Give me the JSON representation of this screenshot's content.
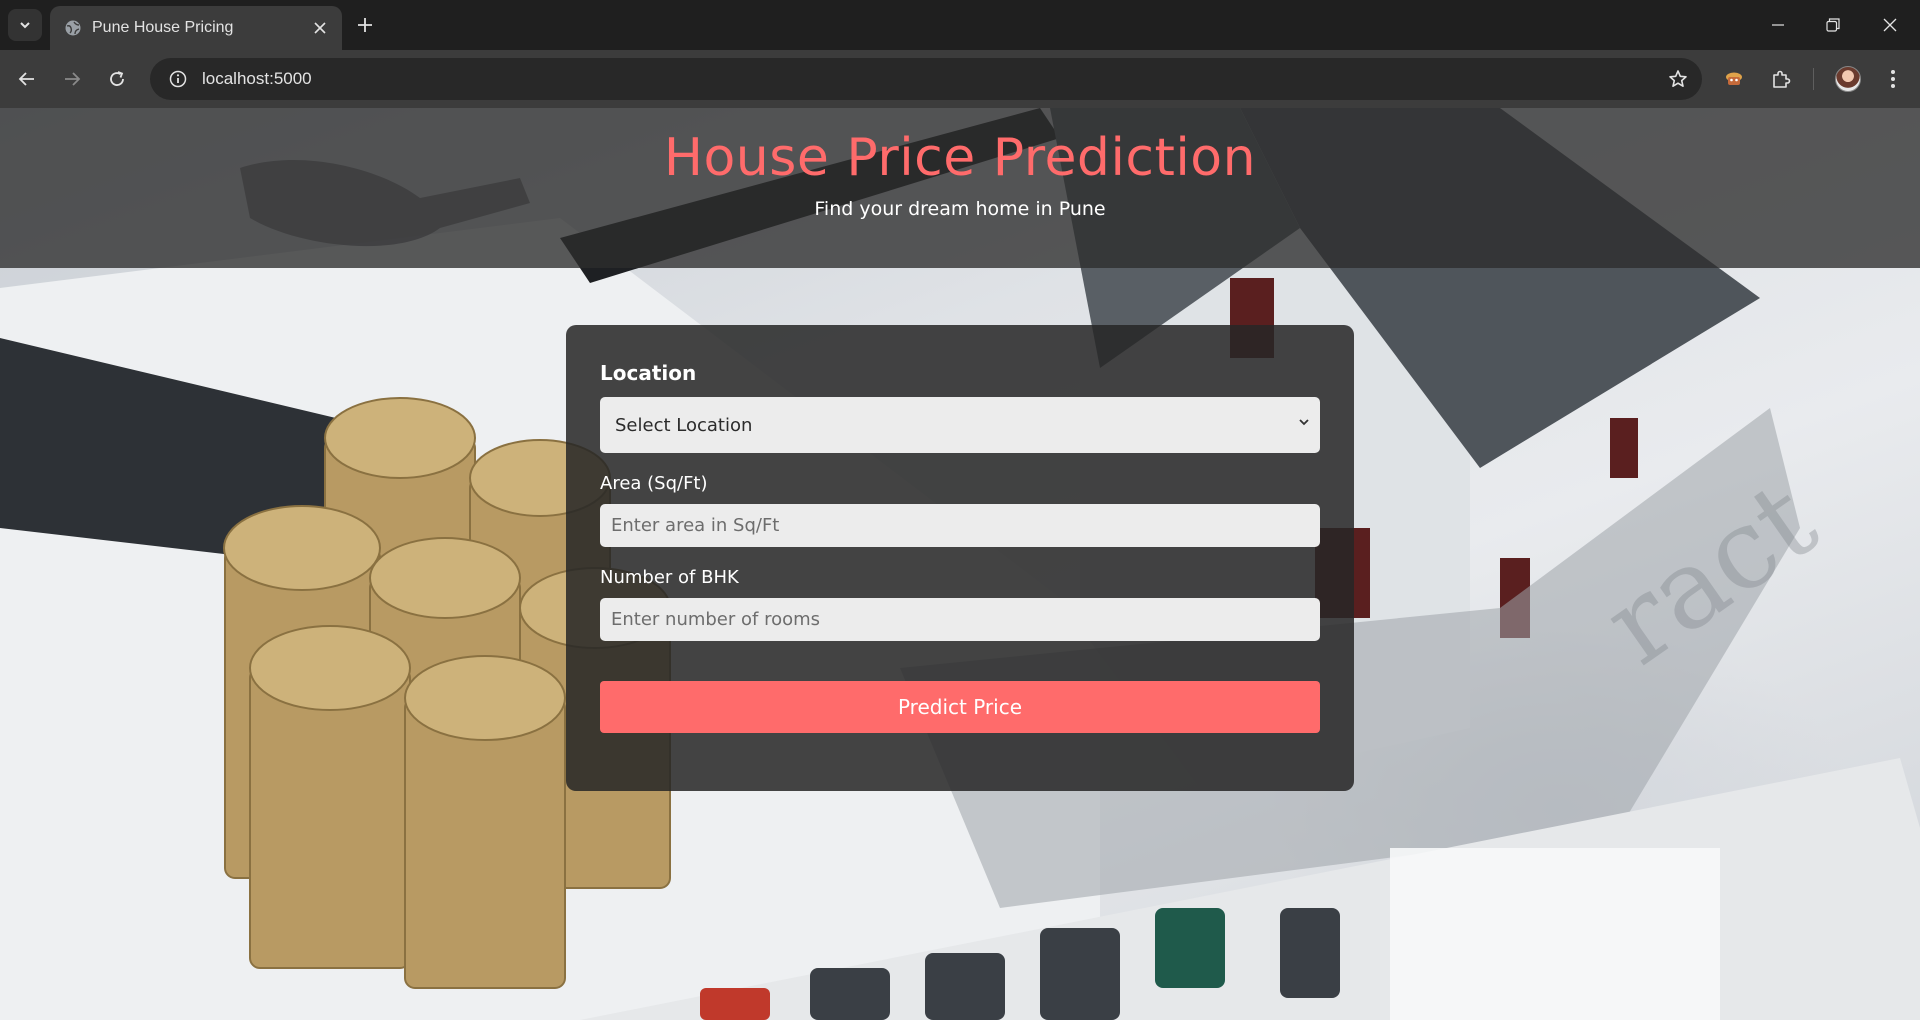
{
  "browser": {
    "tab": {
      "title": "Pune House Pricing",
      "favicon": "globe-icon"
    },
    "address": {
      "url": "localhost:5000"
    },
    "icons": {
      "tab_search": "chevron-down-icon",
      "close_tab": "close-icon",
      "new_tab": "plus-icon",
      "back": "arrow-left-icon",
      "forward": "arrow-right-icon",
      "reload": "reload-icon",
      "site_info": "info-icon",
      "bookmark": "star-icon",
      "extension": "puzzle-icon",
      "menu": "kebab-menu-icon"
    }
  },
  "page": {
    "title": "House Price Prediction",
    "subtitle": "Find your dream home in Pune",
    "form": {
      "location_label": "Location",
      "location_selected": "Select Location",
      "area_label": "Area (Sq/Ft)",
      "area_placeholder": "Enter area in Sq/Ft",
      "bhk_label": "Number of BHK",
      "bhk_placeholder": "Enter number of rooms",
      "submit_label": "Predict Price"
    }
  },
  "colors": {
    "accent": "#ff6b6b",
    "hero_overlay": "#2d2d2d",
    "card_bg": "#262626",
    "input_bg": "#ececec"
  }
}
